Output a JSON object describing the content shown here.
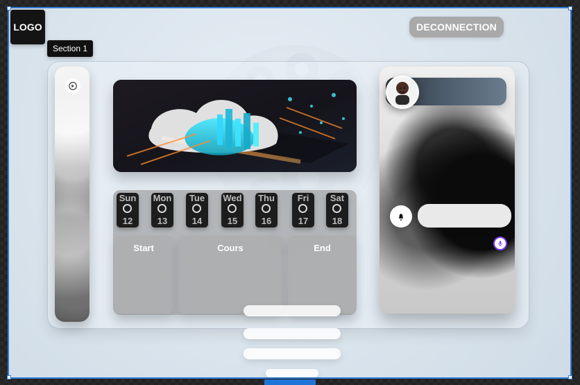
{
  "header": {
    "logo_text": "LOGO",
    "section_label": "Section 1",
    "logout_label": "DECONNECTION"
  },
  "calendar": {
    "days": [
      {
        "name": "Sun",
        "date": "12"
      },
      {
        "name": "Mon",
        "date": "13"
      },
      {
        "name": "Tue",
        "date": "14"
      },
      {
        "name": "Wed",
        "date": "15"
      },
      {
        "name": "Thu",
        "date": "16"
      },
      {
        "name": "Fri",
        "date": "17"
      },
      {
        "name": "Sat",
        "date": "18"
      }
    ],
    "columns": {
      "start_label": "Start",
      "courses_label": "Cours",
      "end_label": "End"
    }
  },
  "icons": {
    "left_rail": "app-icon",
    "notifications": "bell-icon",
    "microphone": "microphone-icon"
  },
  "colors": {
    "selection_blue": "#2f7ad6",
    "logout_bg": "#a9a9a9",
    "mic_accent": "#7c3aed"
  }
}
